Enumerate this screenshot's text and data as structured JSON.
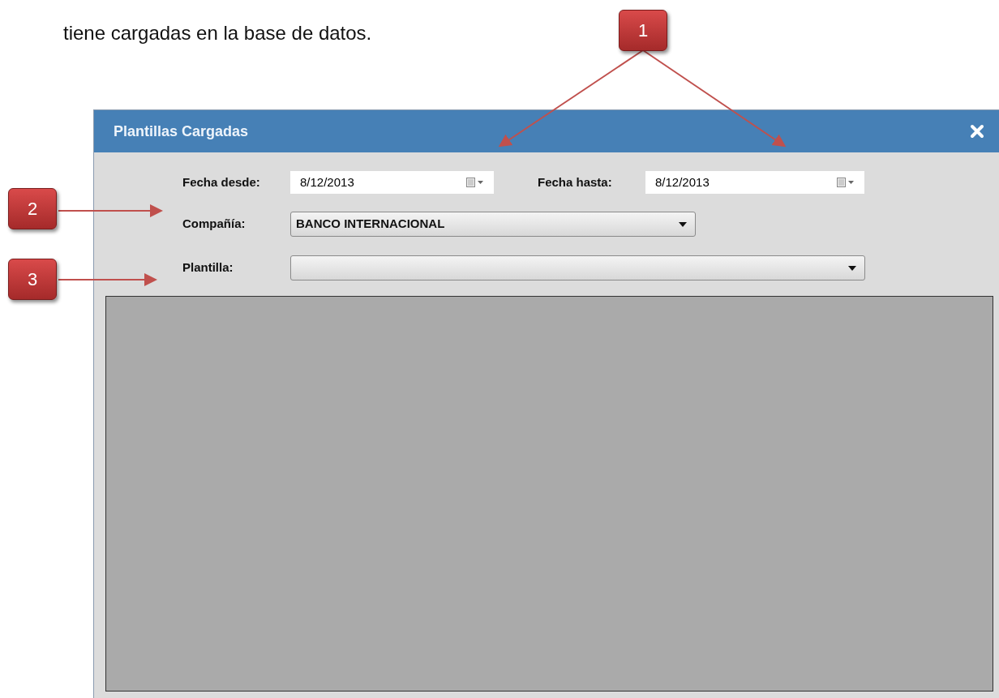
{
  "document_text": "tiene cargadas en la base de datos.",
  "callouts": [
    {
      "label": "1"
    },
    {
      "label": "2"
    },
    {
      "label": "3"
    }
  ],
  "window": {
    "title": "Plantillas Cargadas",
    "date_from": {
      "label": "Fecha desde:",
      "value": "8/12/2013"
    },
    "date_to": {
      "label": "Fecha hasta:",
      "value": "8/12/2013"
    },
    "company": {
      "label": "Compañía:",
      "value": "BANCO INTERNACIONAL"
    },
    "template": {
      "label": "Plantilla:"
    }
  }
}
